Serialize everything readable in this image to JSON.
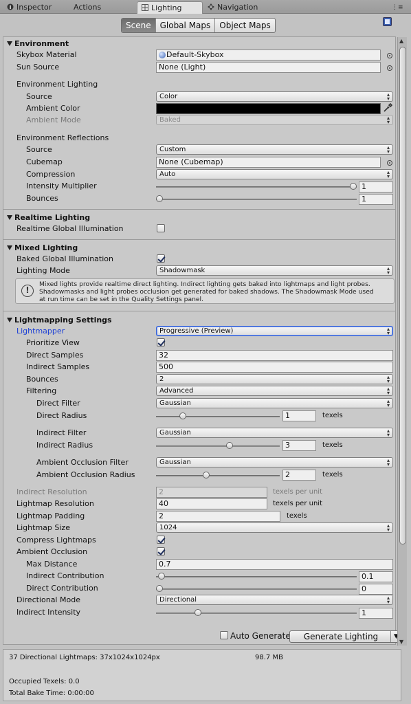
{
  "tabs": [
    {
      "label": "Inspector",
      "icon": "info-icon"
    },
    {
      "label": "Actions",
      "icon": ""
    },
    {
      "label": "Lighting",
      "icon": "lighting-icon",
      "active": true
    },
    {
      "label": "Navigation",
      "icon": "navigation-icon"
    }
  ],
  "modes": [
    "Scene",
    "Global Maps",
    "Object Maps"
  ],
  "environment": {
    "header": "Environment",
    "skybox_material_label": "Skybox Material",
    "skybox_material_value": "Default-Skybox",
    "sun_source_label": "Sun Source",
    "sun_source_value": "None (Light)",
    "env_lighting_label": "Environment Lighting",
    "source_label": "Source",
    "source_value": "Color",
    "ambient_color_label": "Ambient Color",
    "ambient_color": "#000000",
    "ambient_mode_label": "Ambient Mode",
    "ambient_mode_value": "Baked",
    "env_reflections_label": "Environment Reflections",
    "refl_source_label": "Source",
    "refl_source_value": "Custom",
    "cubemap_label": "Cubemap",
    "cubemap_value": "None (Cubemap)",
    "compression_label": "Compression",
    "compression_value": "Auto",
    "intensity_label": "Intensity Multiplier",
    "intensity_value": "1",
    "intensity_fraction": 1.0,
    "bounces_label": "Bounces",
    "bounces_value": "1",
    "bounces_fraction": 0.0
  },
  "realtime": {
    "header": "Realtime Lighting",
    "rtgi_label": "Realtime Global Illumination",
    "rtgi_checked": false
  },
  "mixed": {
    "header": "Mixed Lighting",
    "bgi_label": "Baked Global Illumination",
    "bgi_checked": true,
    "mode_label": "Lighting Mode",
    "mode_value": "Shadowmask",
    "help_line1": "Mixed lights provide realtime direct lighting. Indirect lighting gets baked into lightmaps and light probes.",
    "help_line2": "Shadowmasks and light probes occlusion get generated for baked shadows. The Shadowmask Mode used",
    "help_line3": "at run time can be set in the Quality Settings panel."
  },
  "lightmapping": {
    "header": "Lightmapping Settings",
    "lightmapper_label": "Lightmapper",
    "lightmapper_value": "Progressive (Preview)",
    "prioritize_label": "Prioritize View",
    "prioritize_checked": true,
    "direct_samples_label": "Direct Samples",
    "direct_samples_value": "32",
    "indirect_samples_label": "Indirect Samples",
    "indirect_samples_value": "500",
    "bounces_label": "Bounces",
    "bounces_value": "2",
    "filtering_label": "Filtering",
    "filtering_value": "Advanced",
    "direct_filter_label": "Direct Filter",
    "direct_filter_value": "Gaussian",
    "direct_radius_label": "Direct Radius",
    "direct_radius_value": "1",
    "direct_radius_fraction": 0.2,
    "indirect_filter_label": "Indirect Filter",
    "indirect_filter_value": "Gaussian",
    "indirect_radius_label": "Indirect Radius",
    "indirect_radius_value": "3",
    "indirect_radius_fraction": 0.6,
    "ao_filter_label": "Ambient Occlusion Filter",
    "ao_filter_value": "Gaussian",
    "ao_radius_label": "Ambient Occlusion Radius",
    "ao_radius_value": "2",
    "ao_radius_fraction": 0.4,
    "texels": "texels",
    "indirect_res_label": "Indirect Resolution",
    "indirect_res_value": "2",
    "texels_per_unit": "texels per unit",
    "lightmap_res_label": "Lightmap Resolution",
    "lightmap_res_value": "40",
    "lightmap_padding_label": "Lightmap Padding",
    "lightmap_padding_value": "2",
    "lightmap_size_label": "Lightmap Size",
    "lightmap_size_value": "1024",
    "compress_label": "Compress Lightmaps",
    "compress_checked": true,
    "ao_label": "Ambient Occlusion",
    "ao_checked": true,
    "max_distance_label": "Max Distance",
    "max_distance_value": "0.7",
    "indirect_contrib_label": "Indirect Contribution",
    "indirect_contrib_value": "0.1",
    "indirect_contrib_fraction": 0.01,
    "direct_contrib_label": "Direct Contribution",
    "direct_contrib_value": "0",
    "direct_contrib_fraction": 0.0,
    "directional_mode_label": "Directional Mode",
    "directional_mode_value": "Directional",
    "indirect_intensity_label": "Indirect Intensity",
    "indirect_intensity_value": "1",
    "indirect_intensity_fraction": 0.2
  },
  "generate": {
    "auto_label": "Auto Generate",
    "auto_checked": false,
    "button_label": "Generate Lighting"
  },
  "stats": {
    "lightmaps": "37 Directional Lightmaps: 37x1024x1024px",
    "size": "98.7 MB",
    "occupied": "Occupied Texels: 0.0",
    "bake_time": "Total Bake Time: 0:00:00"
  }
}
